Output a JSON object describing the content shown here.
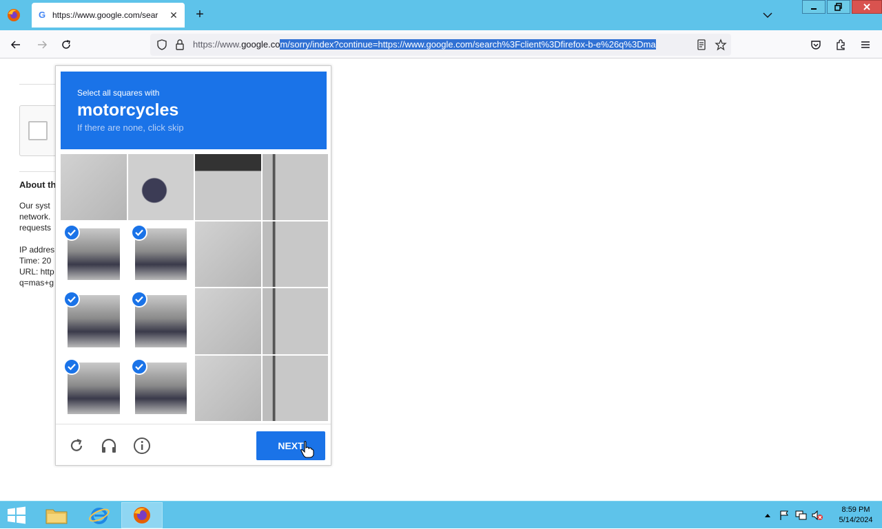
{
  "browser": {
    "tab_title": "https://www.google.com/sear",
    "url_prefix": "https://www.",
    "url_host": "google.co",
    "url_selected": "m/sorry/index?continue=https://www.google.com/search%3Fclient%3Dfirefox-b-e%26q%3Dma"
  },
  "page": {
    "about_heading": "About th",
    "para_lines": [
      "Our syst",
      "network.",
      "requests"
    ],
    "ip_line": "IP addres",
    "time_line": "Time: 20",
    "url_line": "URL: http",
    "q_line": "q=mas+g"
  },
  "challenge": {
    "instruction": "Select all squares with",
    "target": "motorcycles",
    "hint": "If there are none, click skip",
    "next_label": "NEXT",
    "tiles": [
      {
        "selected": false
      },
      {
        "selected": false
      },
      {
        "selected": false
      },
      {
        "selected": false
      },
      {
        "selected": true
      },
      {
        "selected": true
      },
      {
        "selected": false
      },
      {
        "selected": false
      },
      {
        "selected": true
      },
      {
        "selected": true
      },
      {
        "selected": false
      },
      {
        "selected": false
      },
      {
        "selected": true
      },
      {
        "selected": true
      },
      {
        "selected": false
      },
      {
        "selected": false
      }
    ]
  },
  "taskbar": {
    "time": "8:59 PM",
    "date": "5/14/2024"
  },
  "colors": {
    "accent": "#1a73e8",
    "taskbar": "#5ec3ea"
  }
}
